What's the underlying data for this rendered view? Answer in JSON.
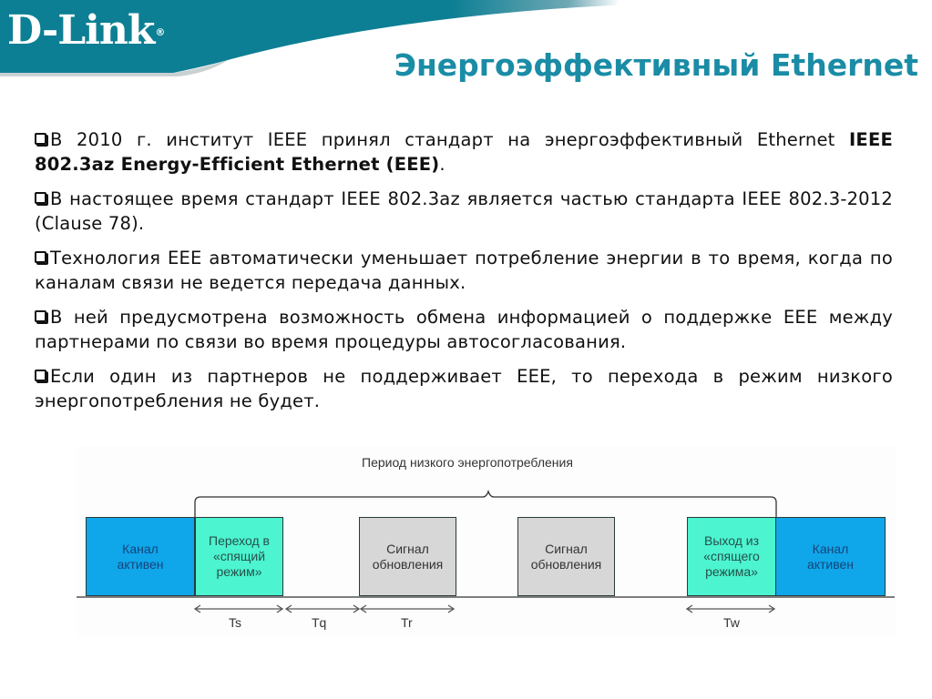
{
  "header": {
    "logo": "D-Link",
    "logo_mark": "®",
    "title": "Энергоэффективный Ethernet",
    "brand_color": "#0d7f94",
    "title_color": "#1a8ca6"
  },
  "bullets": [
    {
      "pre": "В 2010 г. институт IEEE принял стандарт на энергоэффективный Ethernet ",
      "bold": "IEEE 802.3az Energy-Efficient Ethernet (EEE)",
      "post": "."
    },
    {
      "pre": "В настоящее время стандарт IEEE 802.3az является частью стандарта IEEE 802.3-2012 (Clause 78).",
      "bold": "",
      "post": ""
    },
    {
      "pre": "Технология EEE автоматически уменьшает потребление энергии в то время, когда по каналам связи не ведется передача данных.",
      "bold": "",
      "post": ""
    },
    {
      "pre": "В ней предусмотрена возможность обмена информацией о поддержке EEE между партнерами по связи во время процедуры автосогласования.",
      "bold": "",
      "post": ""
    },
    {
      "pre": "Если один из партнеров не поддерживает EEE, то перехода в режим низкого энергопотребления не будет.",
      "bold": "",
      "post": ""
    }
  ],
  "diagram": {
    "period_label": "Период низкого энергопотребления",
    "blocks": [
      {
        "id": "active-left",
        "type": "active",
        "lines": [
          "Канал",
          "активен"
        ]
      },
      {
        "id": "sleep-enter",
        "type": "trans",
        "lines": [
          "Переход в",
          "«спящий",
          "режим»"
        ]
      },
      {
        "id": "refresh-1",
        "type": "sig",
        "lines": [
          "Сигнал",
          "обновления"
        ]
      },
      {
        "id": "refresh-2",
        "type": "sig",
        "lines": [
          "Сигнал",
          "обновления"
        ]
      },
      {
        "id": "sleep-exit",
        "type": "trans",
        "lines": [
          "Выход из",
          "«спящего",
          "режима»"
        ]
      },
      {
        "id": "active-right",
        "type": "active",
        "lines": [
          "Канал",
          "активен"
        ]
      }
    ],
    "intervals": {
      "ts": "Ts",
      "tq": "Tq",
      "tr": "Tr",
      "tw": "Tw"
    },
    "colors": {
      "active": "#0fa6ea",
      "transition": "#4cf4d0",
      "signal": "#d7d7d7"
    }
  }
}
